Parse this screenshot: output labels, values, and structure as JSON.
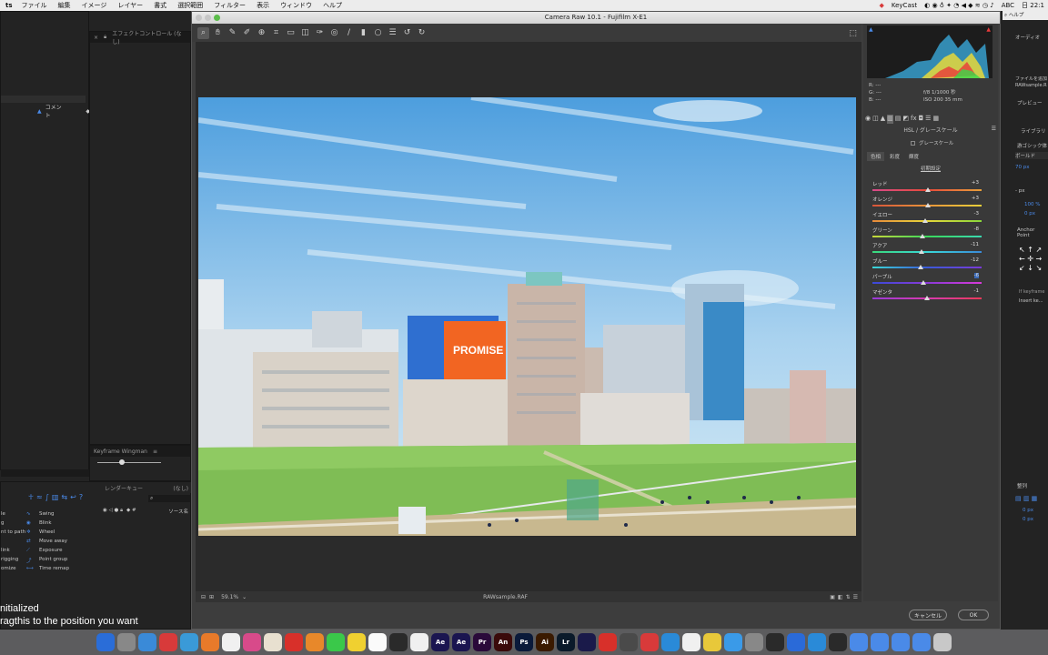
{
  "menubar": {
    "app": "ts",
    "items": [
      "ファイル",
      "編集",
      "イメージ",
      "レイヤー",
      "書式",
      "選択範囲",
      "フィルター",
      "表示",
      "ウィンドウ",
      "ヘルプ"
    ],
    "keycast": "KeyCast",
    "input": "ABC",
    "clock": "日 22:1"
  },
  "ae_left": {
    "effect_controls_tab": "エフェクトコントロール (なし)",
    "comment_label": "コメント",
    "keyframe_wingman": "Keyframe Wingman",
    "render_queue_tab": "レンダーキュー",
    "render_queue_none": "(なし)",
    "source_name_col": "ソース名",
    "motion_tools": [
      {
        "left": "le",
        "right": "Swing"
      },
      {
        "left": "g",
        "right": "Blink"
      },
      {
        "left": "nt to path",
        "right": "Wheel"
      },
      {
        "left": "",
        "right": "Move away"
      },
      {
        "left": "link",
        "right": "Exposure"
      },
      {
        "left": "rigging",
        "right": "Point group"
      },
      {
        "left": "omize",
        "right": "Time remap"
      }
    ]
  },
  "overlay": {
    "line1": "nitialized",
    "line2": "ragthis to the position you want"
  },
  "camera_raw": {
    "title": "Camera Raw 10.1  -  Fujifilm X-E1",
    "zoom": "59.1%",
    "filename": "RAWsample.RAF",
    "histogram": {
      "r": "R:  ---",
      "g": "G:  ---",
      "b": "B:  ---",
      "aperture_shutter": "f/8   1/1000 秒",
      "iso_focal": "ISO 200   35 mm"
    },
    "panel_title": "HSL / グレースケール",
    "grayscale_label": "グレースケール",
    "tabs": [
      "色相",
      "彩度",
      "輝度"
    ],
    "default_link": "初期設定",
    "sliders": [
      {
        "label": "レッド",
        "value": "+3",
        "pos": 0.51,
        "track": "linear-gradient(90deg,#d84a8a,#e84a3a,#e8a03a)"
      },
      {
        "label": "オレンジ",
        "value": "+3",
        "pos": 0.51,
        "track": "linear-gradient(90deg,#d8553a,#e8943a,#e8d03a)"
      },
      {
        "label": "イエロー",
        "value": "-3",
        "pos": 0.48,
        "track": "linear-gradient(90deg,#e88a3a,#e8d83a,#8ad83a)"
      },
      {
        "label": "グリーン",
        "value": "-8",
        "pos": 0.46,
        "track": "linear-gradient(90deg,#c8d83a,#3ad85a,#3ad8b0)"
      },
      {
        "label": "アクア",
        "value": "-11",
        "pos": 0.45,
        "track": "linear-gradient(90deg,#3ad87a,#3ad8d8,#3a8ad8)"
      },
      {
        "label": "ブルー",
        "value": "-12",
        "pos": 0.44,
        "track": "linear-gradient(90deg,#3ad8d8,#3a5ad8,#7a3ad8)"
      },
      {
        "label": "パープル",
        "value": "-6",
        "pos": 0.47,
        "track": "linear-gradient(90deg,#3a4ad8,#8a3ad8,#d83ad8)"
      },
      {
        "label": "マゼンタ",
        "value": "-1",
        "pos": 0.5,
        "track": "linear-gradient(90deg,#9a3ad8,#d83ab0,#e83a5a)"
      }
    ],
    "cancel": "キャンセル",
    "ok": "OK"
  },
  "ae_right": {
    "audio_tab": "オーディオ",
    "add_file_text": "ファイルを追加",
    "raw_sample": "RAWsample.R",
    "preview_tab": "プレビュー",
    "library_tab": "ライブラリ",
    "font_name": "游ゴシック体",
    "font_style": "ボールド",
    "font_size": "70 px",
    "tracking": "100 %",
    "baseline": "0 px",
    "px_dash": "- px",
    "anchor_point": "Anchor Point",
    "if_keyframe": "If keyframe",
    "insert_key": "Insert ke...",
    "align_tab": "整列",
    "offset1": "0 px",
    "offset2": "0 px",
    "help": "ヘルプ"
  },
  "dock": {
    "apps": [
      {
        "label": "",
        "color": "#2a6dd8"
      },
      {
        "label": "",
        "color": "#888"
      },
      {
        "label": "",
        "color": "#3a8ad8"
      },
      {
        "label": "",
        "color": "#d83a3a"
      },
      {
        "label": "",
        "color": "#3a9ad8"
      },
      {
        "label": "",
        "color": "#e87a2a"
      },
      {
        "label": "",
        "color": "#f0f0f0"
      },
      {
        "label": "",
        "color": "#d84a8a"
      },
      {
        "label": "",
        "color": "#e8e0d0"
      },
      {
        "label": "",
        "color": "#d8302a"
      },
      {
        "label": "",
        "color": "#e8882a"
      },
      {
        "label": "",
        "color": "#3ac84a"
      },
      {
        "label": "",
        "color": "#f0d030"
      },
      {
        "label": "",
        "color": "#fafafa"
      },
      {
        "label": "",
        "color": "#2a2a2a"
      },
      {
        "label": "",
        "color": "#f0f0f0"
      },
      {
        "label": "Ae",
        "color": "#1a1550"
      },
      {
        "label": "Ae",
        "color": "#1a1550"
      },
      {
        "label": "Pr",
        "color": "#2a0a3a"
      },
      {
        "label": "An",
        "color": "#3a0a0a"
      },
      {
        "label": "Ps",
        "color": "#0a1a3a"
      },
      {
        "label": "Ai",
        "color": "#3a1a00"
      },
      {
        "label": "Lr",
        "color": "#0a1a2a"
      },
      {
        "label": "",
        "color": "#1a1a4a"
      },
      {
        "label": "",
        "color": "#d8302a"
      },
      {
        "label": "",
        "color": "#4a4a4a"
      },
      {
        "label": "",
        "color": "#d83a3a"
      },
      {
        "label": "",
        "color": "#2a8ad8"
      },
      {
        "label": "",
        "color": "#f0f0f0"
      },
      {
        "label": "",
        "color": "#e8c83a"
      },
      {
        "label": "",
        "color": "#3a9ae8"
      },
      {
        "label": "",
        "color": "#888"
      },
      {
        "label": "",
        "color": "#2a2a2a"
      },
      {
        "label": "",
        "color": "#2a6ad8"
      },
      {
        "label": "",
        "color": "#2a8ad8"
      },
      {
        "label": "",
        "color": "#2a2a2a"
      },
      {
        "label": "",
        "color": "#4a8ae8"
      },
      {
        "label": "",
        "color": "#4a8ae8"
      },
      {
        "label": "",
        "color": "#4a8ae8"
      },
      {
        "label": "",
        "color": "#4a8ae8"
      },
      {
        "label": "",
        "color": "#c8c8c8"
      }
    ]
  }
}
